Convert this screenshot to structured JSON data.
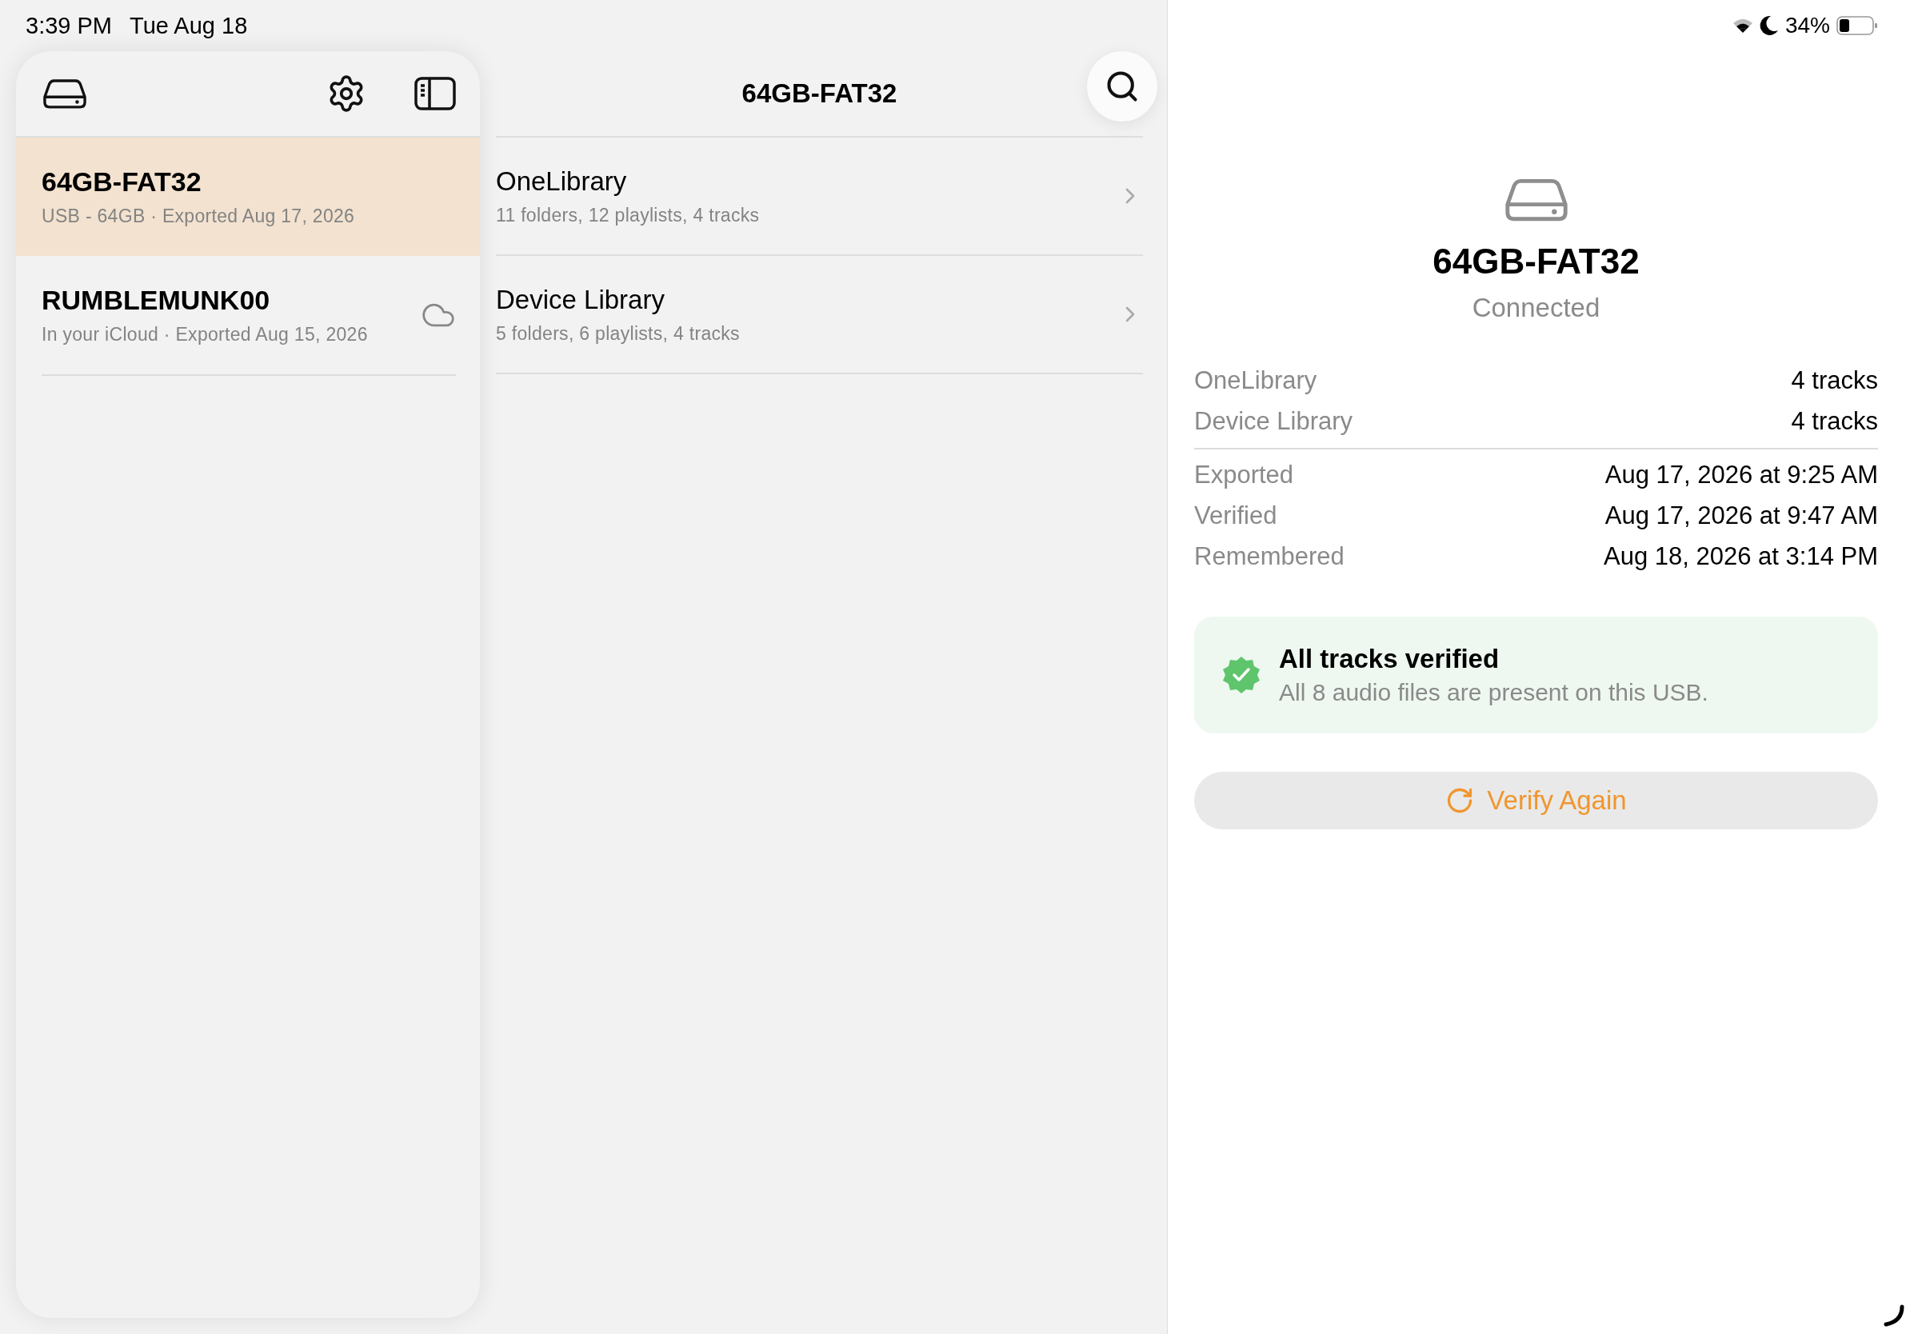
{
  "status_bar": {
    "time": "3:39 PM",
    "date": "Tue Aug 18",
    "battery": "34%"
  },
  "sidebar": {
    "items": [
      {
        "name": "64GB-FAT32",
        "detail": "USB - 64GB · Exported Aug 17, 2026",
        "selected": true,
        "kind": "usb"
      },
      {
        "name": "RUMBLEMUNK00",
        "detail": "In your iCloud · Exported Aug 15, 2026",
        "selected": false,
        "kind": "icloud"
      }
    ]
  },
  "content": {
    "title": "64GB-FAT32",
    "items": [
      {
        "title": "OneLibrary",
        "subtitle": "11 folders, 12 playlists, 4 tracks"
      },
      {
        "title": "Device Library",
        "subtitle": "5 folders, 6 playlists, 4 tracks"
      }
    ]
  },
  "detail": {
    "name": "64GB-FAT32",
    "status": "Connected",
    "library_rows": [
      {
        "label": "OneLibrary",
        "value": "4 tracks"
      },
      {
        "label": "Device Library",
        "value": "4 tracks"
      }
    ],
    "date_rows": [
      {
        "label": "Exported",
        "value": "Aug 17, 2026 at 9:25 AM"
      },
      {
        "label": "Verified",
        "value": "Aug 17, 2026 at 9:47 AM"
      },
      {
        "label": "Remembered",
        "value": "Aug 18, 2026 at 3:14 PM"
      }
    ],
    "banner": {
      "title": "All tracks verified",
      "message": "All 8 audio files are present on this USB."
    },
    "action_button": "Verify Again"
  }
}
